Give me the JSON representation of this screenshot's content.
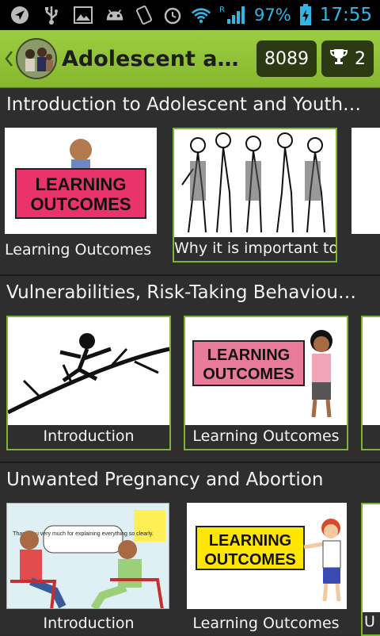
{
  "status_bar": {
    "battery": "97%",
    "time": "17:55",
    "network_letter": "R"
  },
  "action_bar": {
    "title": "Adolescent and…",
    "points": "8089",
    "trophies": "2"
  },
  "sections": [
    {
      "title": "Introduction to Adolescent and Youth…",
      "cards": [
        {
          "label": "Learning Outcomes",
          "image_text": "LEARNING OUTCOMES"
        },
        {
          "label": "Why it is important to",
          "image_text": ""
        }
      ]
    },
    {
      "title": "Vulnerabilities, Risk-Taking Behaviours,…",
      "cards": [
        {
          "label": "Introduction",
          "image_text": ""
        },
        {
          "label": "Learning Outcomes",
          "image_text": "LEARNING OUTCOMES"
        }
      ]
    },
    {
      "title": "Unwanted Pregnancy and Abortion",
      "cards": [
        {
          "label": "Introduction",
          "image_text": "Thank you very much for explaining everything so clearly."
        },
        {
          "label": "Learning Outcomes",
          "image_text": "LEARNING OUTCOMES"
        },
        {
          "label": "U",
          "image_text": ""
        }
      ]
    }
  ],
  "colors": {
    "action_bar": "#8fc136",
    "accent_outline": "#7ab53a",
    "status_icons": "#33b5e5"
  }
}
